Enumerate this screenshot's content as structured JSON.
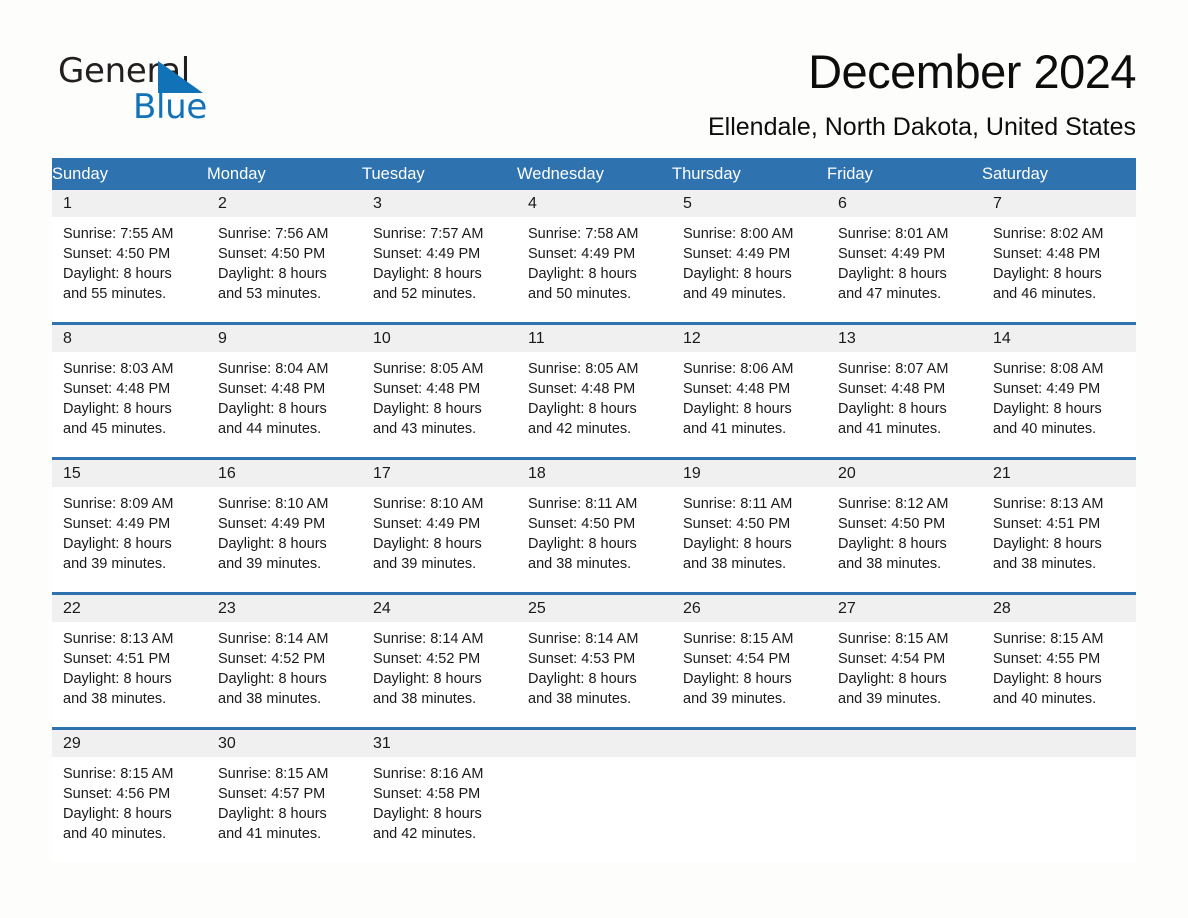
{
  "brand": {
    "name_part1": "General",
    "name_part2": "Blue",
    "triangle_color": "#1272b8",
    "icon": "triangle-logo-icon"
  },
  "header": {
    "month_title": "December 2024",
    "location": "Ellendale, North Dakota, United States"
  },
  "theme": {
    "header_blue": "#2e72b0",
    "daynum_band": "#f0f0f0",
    "page_background": "#fdfdfc",
    "text": "#1a1a1a"
  },
  "calendar": {
    "weekday_headers": [
      "Sunday",
      "Monday",
      "Tuesday",
      "Wednesday",
      "Thursday",
      "Friday",
      "Saturday"
    ],
    "weeks": [
      [
        {
          "day": "1",
          "sunrise": "Sunrise: 7:55 AM",
          "sunset": "Sunset: 4:50 PM",
          "daylight_line1": "Daylight: 8 hours",
          "daylight_line2": "and 55 minutes."
        },
        {
          "day": "2",
          "sunrise": "Sunrise: 7:56 AM",
          "sunset": "Sunset: 4:50 PM",
          "daylight_line1": "Daylight: 8 hours",
          "daylight_line2": "and 53 minutes."
        },
        {
          "day": "3",
          "sunrise": "Sunrise: 7:57 AM",
          "sunset": "Sunset: 4:49 PM",
          "daylight_line1": "Daylight: 8 hours",
          "daylight_line2": "and 52 minutes."
        },
        {
          "day": "4",
          "sunrise": "Sunrise: 7:58 AM",
          "sunset": "Sunset: 4:49 PM",
          "daylight_line1": "Daylight: 8 hours",
          "daylight_line2": "and 50 minutes."
        },
        {
          "day": "5",
          "sunrise": "Sunrise: 8:00 AM",
          "sunset": "Sunset: 4:49 PM",
          "daylight_line1": "Daylight: 8 hours",
          "daylight_line2": "and 49 minutes."
        },
        {
          "day": "6",
          "sunrise": "Sunrise: 8:01 AM",
          "sunset": "Sunset: 4:49 PM",
          "daylight_line1": "Daylight: 8 hours",
          "daylight_line2": "and 47 minutes."
        },
        {
          "day": "7",
          "sunrise": "Sunrise: 8:02 AM",
          "sunset": "Sunset: 4:48 PM",
          "daylight_line1": "Daylight: 8 hours",
          "daylight_line2": "and 46 minutes."
        }
      ],
      [
        {
          "day": "8",
          "sunrise": "Sunrise: 8:03 AM",
          "sunset": "Sunset: 4:48 PM",
          "daylight_line1": "Daylight: 8 hours",
          "daylight_line2": "and 45 minutes."
        },
        {
          "day": "9",
          "sunrise": "Sunrise: 8:04 AM",
          "sunset": "Sunset: 4:48 PM",
          "daylight_line1": "Daylight: 8 hours",
          "daylight_line2": "and 44 minutes."
        },
        {
          "day": "10",
          "sunrise": "Sunrise: 8:05 AM",
          "sunset": "Sunset: 4:48 PM",
          "daylight_line1": "Daylight: 8 hours",
          "daylight_line2": "and 43 minutes."
        },
        {
          "day": "11",
          "sunrise": "Sunrise: 8:05 AM",
          "sunset": "Sunset: 4:48 PM",
          "daylight_line1": "Daylight: 8 hours",
          "daylight_line2": "and 42 minutes."
        },
        {
          "day": "12",
          "sunrise": "Sunrise: 8:06 AM",
          "sunset": "Sunset: 4:48 PM",
          "daylight_line1": "Daylight: 8 hours",
          "daylight_line2": "and 41 minutes."
        },
        {
          "day": "13",
          "sunrise": "Sunrise: 8:07 AM",
          "sunset": "Sunset: 4:48 PM",
          "daylight_line1": "Daylight: 8 hours",
          "daylight_line2": "and 41 minutes."
        },
        {
          "day": "14",
          "sunrise": "Sunrise: 8:08 AM",
          "sunset": "Sunset: 4:49 PM",
          "daylight_line1": "Daylight: 8 hours",
          "daylight_line2": "and 40 minutes."
        }
      ],
      [
        {
          "day": "15",
          "sunrise": "Sunrise: 8:09 AM",
          "sunset": "Sunset: 4:49 PM",
          "daylight_line1": "Daylight: 8 hours",
          "daylight_line2": "and 39 minutes."
        },
        {
          "day": "16",
          "sunrise": "Sunrise: 8:10 AM",
          "sunset": "Sunset: 4:49 PM",
          "daylight_line1": "Daylight: 8 hours",
          "daylight_line2": "and 39 minutes."
        },
        {
          "day": "17",
          "sunrise": "Sunrise: 8:10 AM",
          "sunset": "Sunset: 4:49 PM",
          "daylight_line1": "Daylight: 8 hours",
          "daylight_line2": "and 39 minutes."
        },
        {
          "day": "18",
          "sunrise": "Sunrise: 8:11 AM",
          "sunset": "Sunset: 4:50 PM",
          "daylight_line1": "Daylight: 8 hours",
          "daylight_line2": "and 38 minutes."
        },
        {
          "day": "19",
          "sunrise": "Sunrise: 8:11 AM",
          "sunset": "Sunset: 4:50 PM",
          "daylight_line1": "Daylight: 8 hours",
          "daylight_line2": "and 38 minutes."
        },
        {
          "day": "20",
          "sunrise": "Sunrise: 8:12 AM",
          "sunset": "Sunset: 4:50 PM",
          "daylight_line1": "Daylight: 8 hours",
          "daylight_line2": "and 38 minutes."
        },
        {
          "day": "21",
          "sunrise": "Sunrise: 8:13 AM",
          "sunset": "Sunset: 4:51 PM",
          "daylight_line1": "Daylight: 8 hours",
          "daylight_line2": "and 38 minutes."
        }
      ],
      [
        {
          "day": "22",
          "sunrise": "Sunrise: 8:13 AM",
          "sunset": "Sunset: 4:51 PM",
          "daylight_line1": "Daylight: 8 hours",
          "daylight_line2": "and 38 minutes."
        },
        {
          "day": "23",
          "sunrise": "Sunrise: 8:14 AM",
          "sunset": "Sunset: 4:52 PM",
          "daylight_line1": "Daylight: 8 hours",
          "daylight_line2": "and 38 minutes."
        },
        {
          "day": "24",
          "sunrise": "Sunrise: 8:14 AM",
          "sunset": "Sunset: 4:52 PM",
          "daylight_line1": "Daylight: 8 hours",
          "daylight_line2": "and 38 minutes."
        },
        {
          "day": "25",
          "sunrise": "Sunrise: 8:14 AM",
          "sunset": "Sunset: 4:53 PM",
          "daylight_line1": "Daylight: 8 hours",
          "daylight_line2": "and 38 minutes."
        },
        {
          "day": "26",
          "sunrise": "Sunrise: 8:15 AM",
          "sunset": "Sunset: 4:54 PM",
          "daylight_line1": "Daylight: 8 hours",
          "daylight_line2": "and 39 minutes."
        },
        {
          "day": "27",
          "sunrise": "Sunrise: 8:15 AM",
          "sunset": "Sunset: 4:54 PM",
          "daylight_line1": "Daylight: 8 hours",
          "daylight_line2": "and 39 minutes."
        },
        {
          "day": "28",
          "sunrise": "Sunrise: 8:15 AM",
          "sunset": "Sunset: 4:55 PM",
          "daylight_line1": "Daylight: 8 hours",
          "daylight_line2": "and 40 minutes."
        }
      ],
      [
        {
          "day": "29",
          "sunrise": "Sunrise: 8:15 AM",
          "sunset": "Sunset: 4:56 PM",
          "daylight_line1": "Daylight: 8 hours",
          "daylight_line2": "and 40 minutes."
        },
        {
          "day": "30",
          "sunrise": "Sunrise: 8:15 AM",
          "sunset": "Sunset: 4:57 PM",
          "daylight_line1": "Daylight: 8 hours",
          "daylight_line2": "and 41 minutes."
        },
        {
          "day": "31",
          "sunrise": "Sunrise: 8:16 AM",
          "sunset": "Sunset: 4:58 PM",
          "daylight_line1": "Daylight: 8 hours",
          "daylight_line2": "and 42 minutes."
        },
        {
          "day": "",
          "sunrise": "",
          "sunset": "",
          "daylight_line1": "",
          "daylight_line2": ""
        },
        {
          "day": "",
          "sunrise": "",
          "sunset": "",
          "daylight_line1": "",
          "daylight_line2": ""
        },
        {
          "day": "",
          "sunrise": "",
          "sunset": "",
          "daylight_line1": "",
          "daylight_line2": ""
        },
        {
          "day": "",
          "sunrise": "",
          "sunset": "",
          "daylight_line1": "",
          "daylight_line2": ""
        }
      ]
    ]
  }
}
